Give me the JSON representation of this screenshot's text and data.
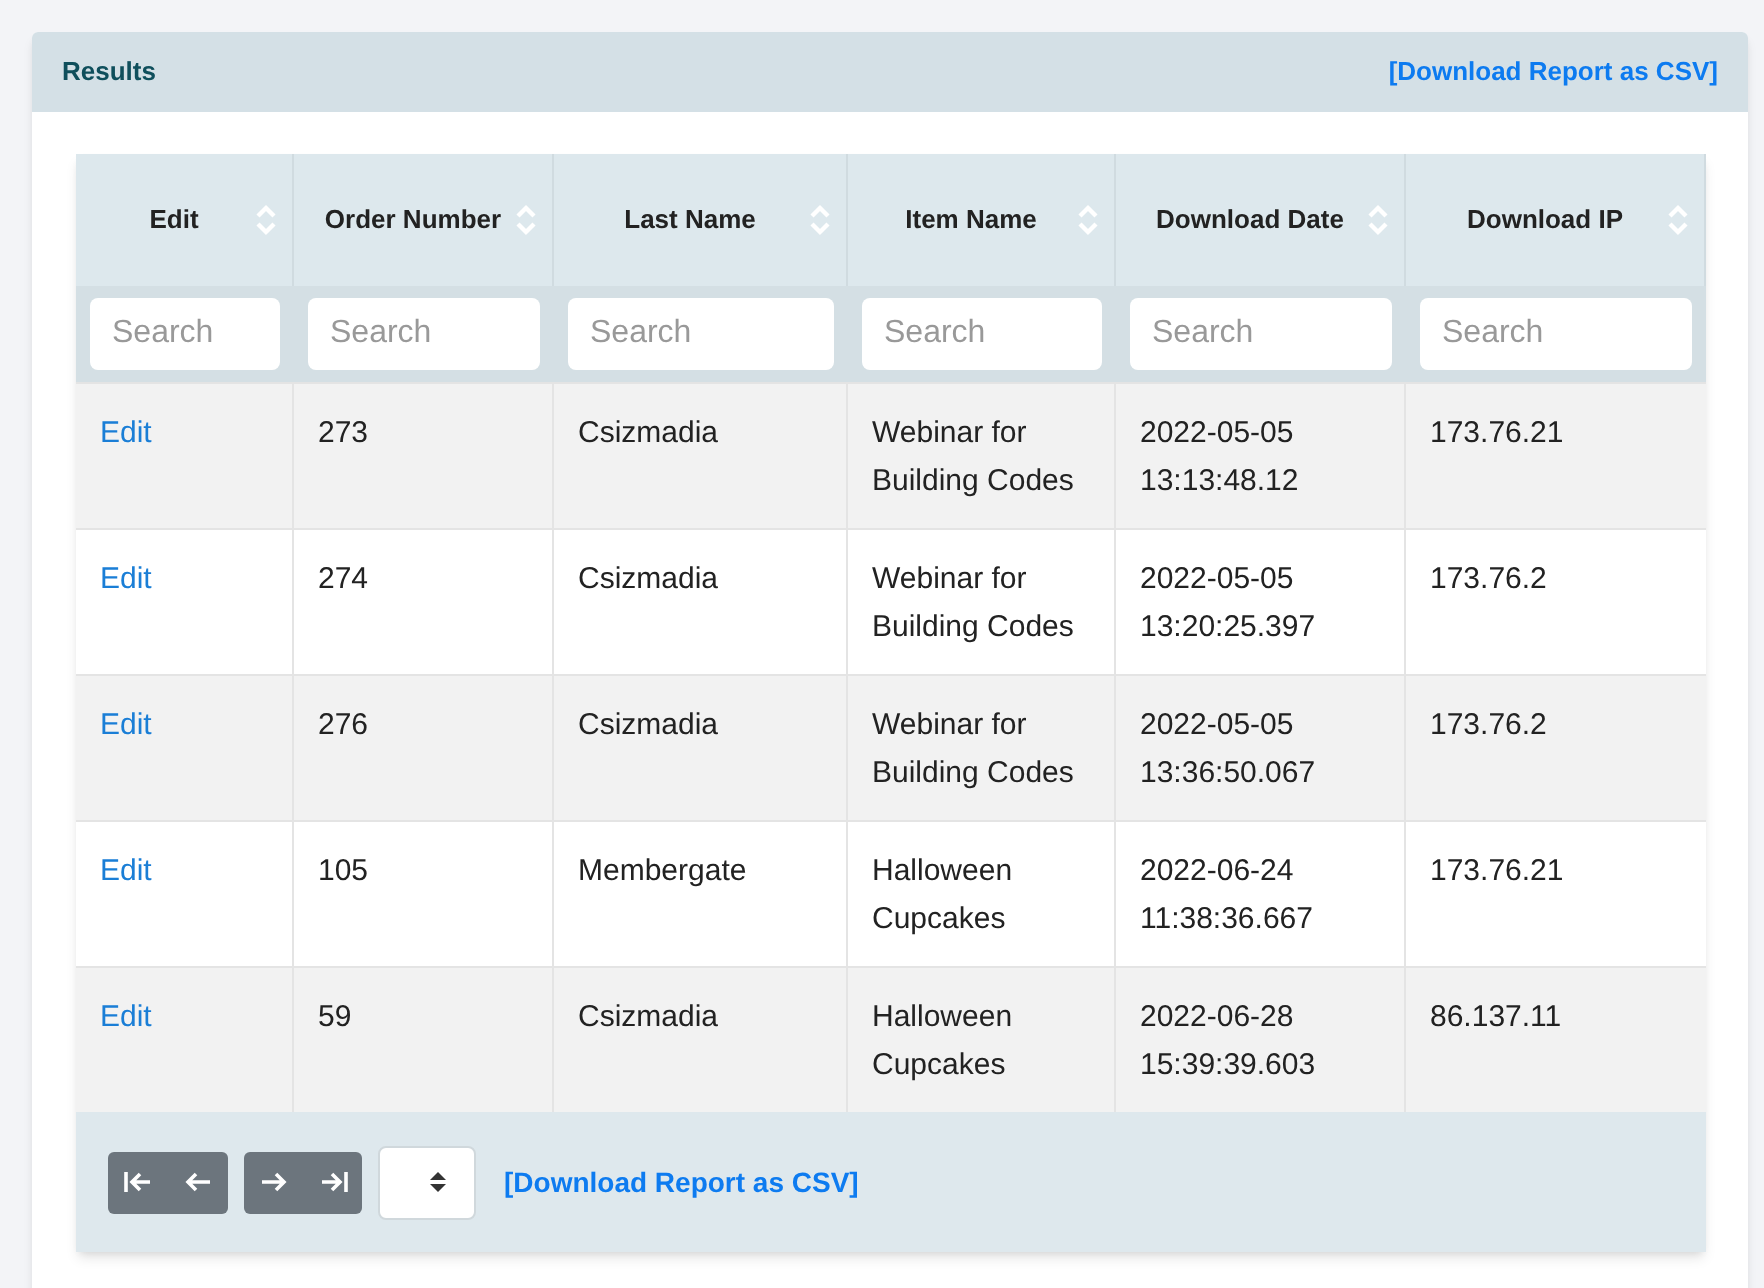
{
  "panel": {
    "title": "Results",
    "download_link": "[Download Report as CSV]"
  },
  "table": {
    "columns": [
      {
        "label": "Edit",
        "placeholder": "Search"
      },
      {
        "label": "Order Number",
        "placeholder": "Search"
      },
      {
        "label": "Last Name",
        "placeholder": "Search"
      },
      {
        "label": "Item Name",
        "placeholder": "Search"
      },
      {
        "label": "Download Date",
        "placeholder": "Search"
      },
      {
        "label": "Download IP",
        "placeholder": "Search"
      }
    ],
    "rows": [
      {
        "edit": "Edit",
        "order": "273",
        "last_name": "Csizmadia",
        "item": "Webinar for Building Codes",
        "date": "2022-05-05 13:13:48.12",
        "ip": "173.76.21"
      },
      {
        "edit": "Edit",
        "order": "274",
        "last_name": "Csizmadia",
        "item": "Webinar for Building Codes",
        "date": "2022-05-05 13:20:25.397",
        "ip": "173.76.2"
      },
      {
        "edit": "Edit",
        "order": "276",
        "last_name": "Csizmadia",
        "item": "Webinar for Building Codes",
        "date": "2022-05-05 13:36:50.067",
        "ip": "173.76.2"
      },
      {
        "edit": "Edit",
        "order": "105",
        "last_name": "Membergate",
        "item": "Halloween Cupcakes",
        "date": "2022-06-24 11:38:36.667",
        "ip": "173.76.21"
      },
      {
        "edit": "Edit",
        "order": "59",
        "last_name": "Csizmadia",
        "item": "Halloween Cupcakes",
        "date": "2022-06-28 15:39:39.603",
        "ip": "86.137.11"
      }
    ]
  },
  "footer": {
    "download_link": "[Download Report as CSV]"
  }
}
